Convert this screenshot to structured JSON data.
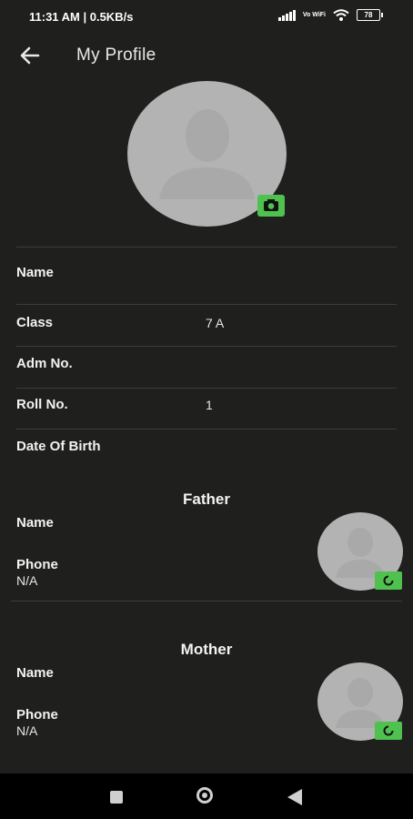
{
  "status_bar": {
    "time_speed": "11:31 AM | 0.5KB/s",
    "network_label": "Vo WiFi",
    "battery": "78"
  },
  "header": {
    "title": "My Profile"
  },
  "profile": {
    "fields": {
      "name": {
        "label": "Name",
        "value": ""
      },
      "class": {
        "label": "Class",
        "value": "7 A"
      },
      "adm_no": {
        "label": "Adm No.",
        "value": ""
      },
      "roll_no": {
        "label": "Roll No.",
        "value": "1"
      },
      "dob": {
        "label": "Date Of Birth",
        "value": ""
      }
    }
  },
  "father": {
    "title": "Father",
    "name_label": "Name",
    "phone_label": "Phone",
    "phone_value": "N/A"
  },
  "mother": {
    "title": "Mother",
    "name_label": "Name",
    "phone_label": "Phone",
    "phone_value": "N/A"
  },
  "colors": {
    "background": "#1f201e",
    "accent_green": "#4fc14f",
    "avatar_gray": "#b3b3b3"
  },
  "icons": {
    "back": "arrow-left-icon",
    "camera": "camera-icon",
    "refresh": "refresh-icon"
  }
}
